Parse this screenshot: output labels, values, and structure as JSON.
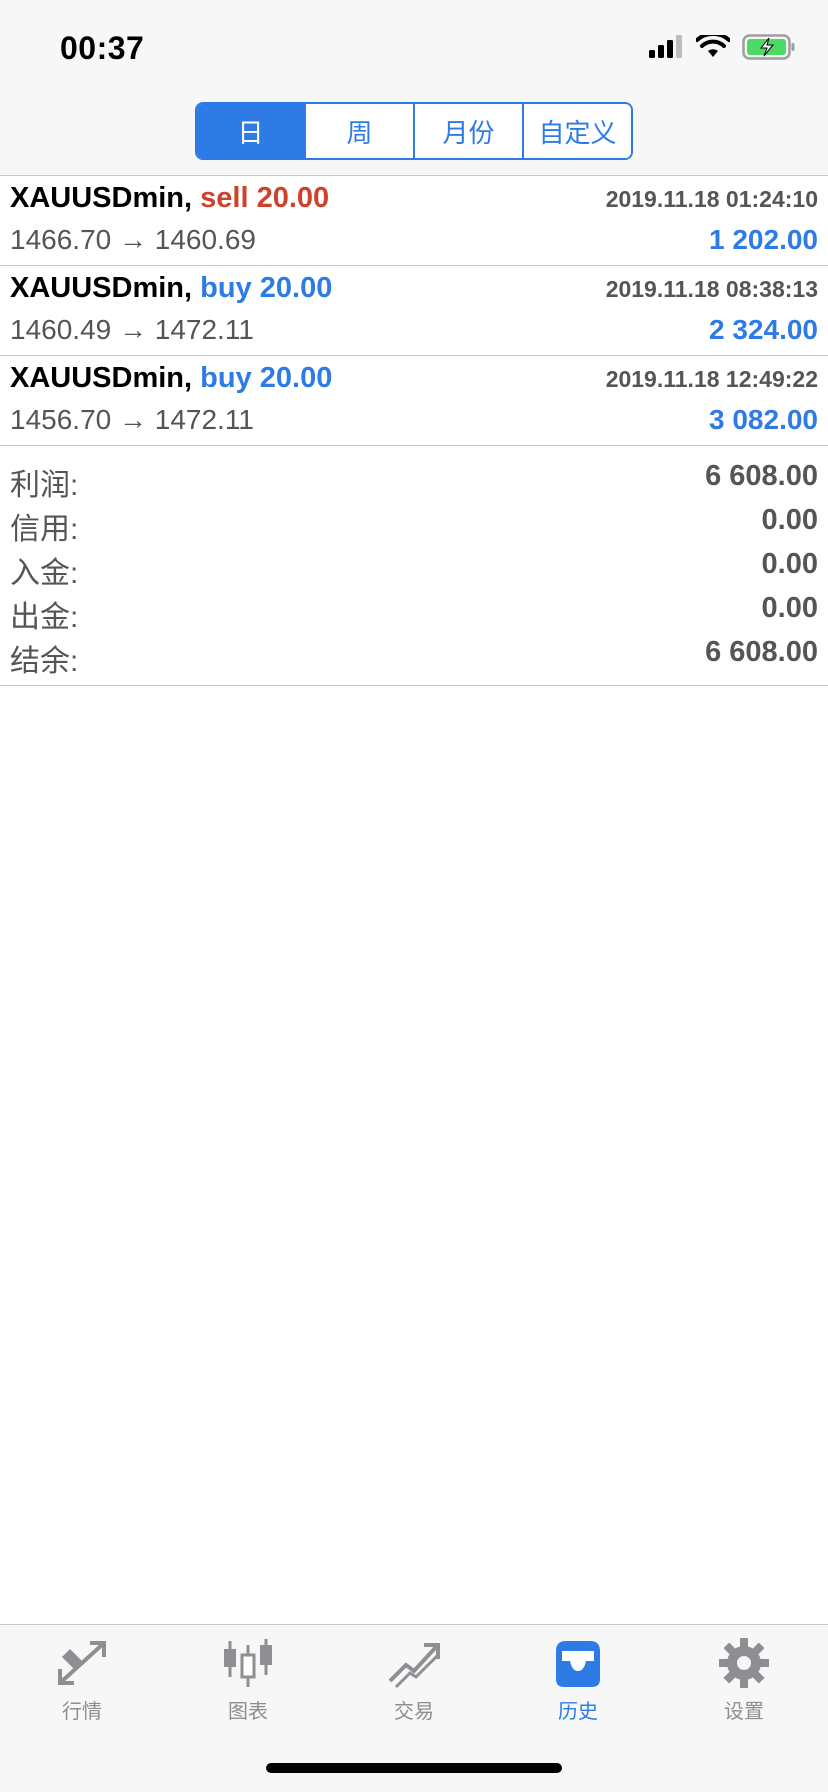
{
  "status_bar": {
    "time": "00:37"
  },
  "period_tabs": [
    {
      "label": "日",
      "active": true
    },
    {
      "label": "周",
      "active": false
    },
    {
      "label": "月份",
      "active": false
    },
    {
      "label": "自定义",
      "active": false
    }
  ],
  "trades": [
    {
      "symbol": "XAUUSDmin,",
      "side": "sell",
      "volume": "20.00",
      "time": "2019.11.18 01:24:10",
      "prices": "1466.70 → 1460.69",
      "profit": "1 202.00"
    },
    {
      "symbol": "XAUUSDmin,",
      "side": "buy",
      "volume": "20.00",
      "time": "2019.11.18 08:38:13",
      "prices": "1460.49 → 1472.11",
      "profit": "2 324.00"
    },
    {
      "symbol": "XAUUSDmin,",
      "side": "buy",
      "volume": "20.00",
      "time": "2019.11.18 12:49:22",
      "prices": "1456.70 → 1472.11",
      "profit": "3 082.00"
    }
  ],
  "summary": [
    {
      "label": "利润:",
      "value": "6 608.00"
    },
    {
      "label": "信用:",
      "value": "0.00"
    },
    {
      "label": "入金:",
      "value": "0.00"
    },
    {
      "label": "出金:",
      "value": "0.00"
    },
    {
      "label": "结余:",
      "value": "6 608.00"
    }
  ],
  "tabbar": [
    {
      "label": "行情",
      "icon": "quotes-arrows-icon",
      "active": false
    },
    {
      "label": "图表",
      "icon": "candlestick-chart-icon",
      "active": false
    },
    {
      "label": "交易",
      "icon": "trade-trend-icon",
      "active": false
    },
    {
      "label": "历史",
      "icon": "history-inbox-icon",
      "active": true
    },
    {
      "label": "设置",
      "icon": "gear-icon",
      "active": false
    }
  ],
  "colors": {
    "accent": "#2f7be5",
    "sell": "#d0402b",
    "secondary_text": "#555555",
    "tab_inactive": "#8e8e93"
  }
}
